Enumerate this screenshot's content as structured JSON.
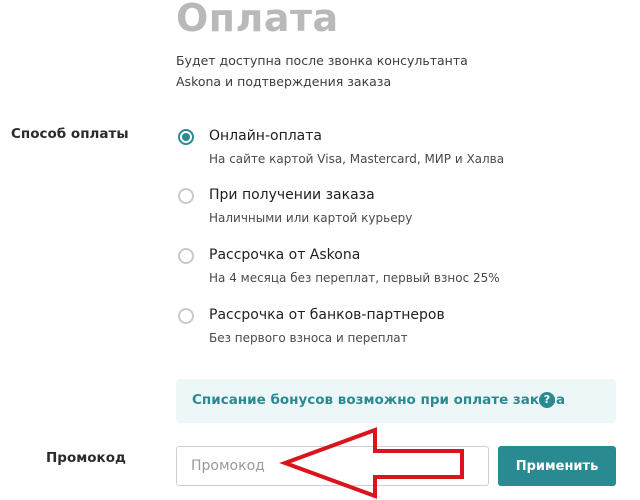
{
  "header": {
    "title": "Оплата",
    "subtitle": "Будет доступна после звонка консультанта Askona и подтверждения заказа"
  },
  "payment": {
    "label": "Способ оплаты",
    "selected_index": 0,
    "options": [
      {
        "title": "Онлайн-оплата",
        "description": "На сайте картой Visa, Mastercard, МИР и Халва"
      },
      {
        "title": "При получении заказа",
        "description": "Наличными или картой курьеру"
      },
      {
        "title": "Рассрочка от Askona",
        "description": "На 4 месяца без переплат, первый взнос 25%"
      },
      {
        "title": "Рассрочка от банков-партнеров",
        "description": "Без первого взноса и переплат"
      }
    ]
  },
  "bonus": {
    "text": "Списание бонусов возможно при оплате заказа",
    "help_icon": "?"
  },
  "promo": {
    "label": "Промокод",
    "placeholder": "Промокод",
    "value": "",
    "button_label": "Применить"
  },
  "colors": {
    "accent": "#2a8a91",
    "info_background": "#eef7f8",
    "title_gray": "#b9b9b9",
    "annotation_arrow": "#d8141c"
  },
  "icons": {
    "radio_checked": "radio-checked-icon",
    "radio_unchecked": "radio-unchecked-icon",
    "help": "question-circle-icon",
    "annotation": "red-arrow-annotation-icon"
  }
}
